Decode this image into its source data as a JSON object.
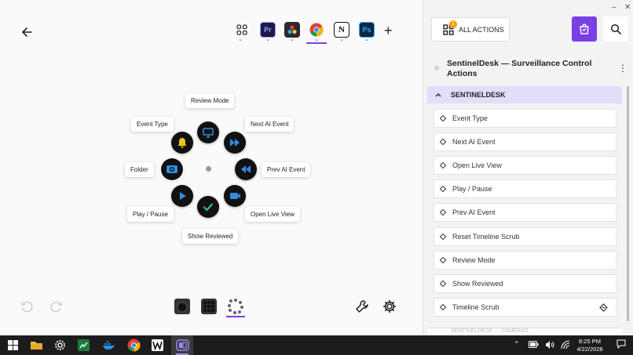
{
  "canvas": {
    "apps": [
      {
        "name": "grid-apps",
        "label": ""
      },
      {
        "name": "premiere-pro",
        "label": "Pr",
        "color": "#1e1a45",
        "fg": "#9999ff"
      },
      {
        "name": "davinci",
        "label": "",
        "color": "#2a2a2a"
      },
      {
        "name": "chrome",
        "label": "",
        "color": "#dd4b39"
      },
      {
        "name": "notion",
        "label": "N",
        "color": "#ffffff"
      },
      {
        "name": "photoshop",
        "label": "Ps",
        "color": "#0b2942",
        "fg": "#31a8ff"
      }
    ],
    "ring_labels": {
      "review_mode": "Review Mode",
      "next_ai_event": "Next AI Event",
      "prev_ai_event": "Prev AI Event",
      "open_live_view": "Open Live View",
      "show_reviewed": "Show Reviewed",
      "play_pause": "Play / Pause",
      "folder": "Folder",
      "event_type": "Event Type"
    }
  },
  "panel": {
    "all_actions_label": "ALL ACTIONS",
    "notification_count": "1",
    "plugin_title": "SentinelDesk — Surveillance Control Actions",
    "section_title": "SENTINELDESK",
    "actions": [
      "Event Type",
      "Next AI Event",
      "Open Live View",
      "Play / Pause",
      "Prev AI Event",
      "Reset Timeline Scrub",
      "Review Mode",
      "Show Reviewed",
      "Timeline Scrub"
    ],
    "next_section_title": "SENTINELDESK — CAMERAS"
  },
  "taskbar": {
    "time": "8:25 PM",
    "date": "4/22/2026"
  },
  "colors": {
    "accent": "#7b3fe4",
    "ring_icon_blue": "#2f8ce0",
    "ring_icon_green": "#2ec27e",
    "ring_icon_yellow": "#f5c211"
  }
}
